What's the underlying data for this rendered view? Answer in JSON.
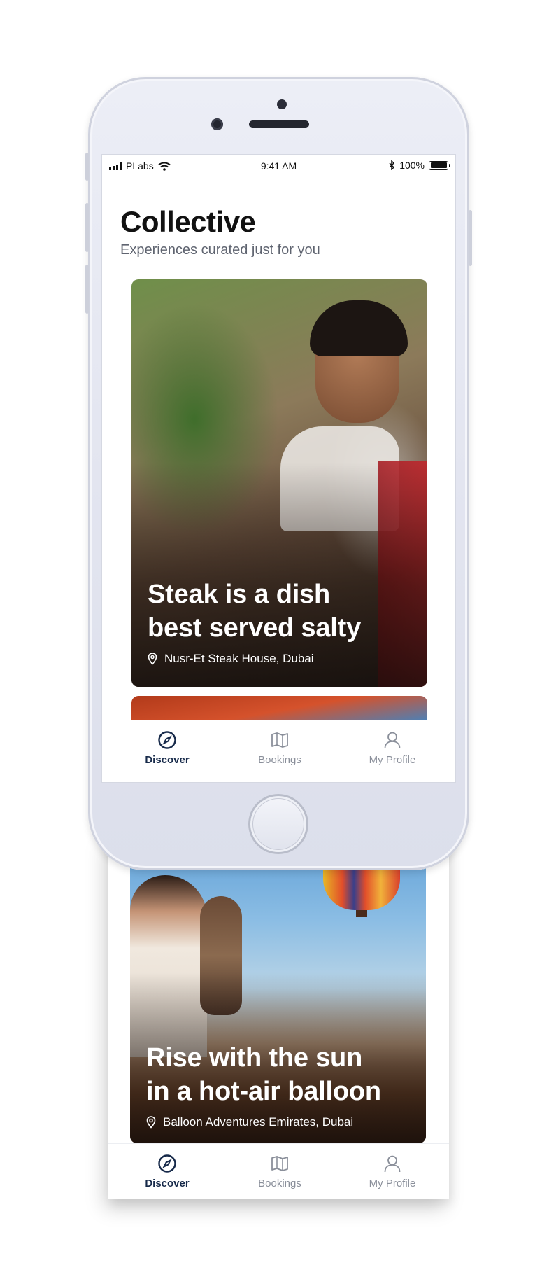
{
  "status_bar": {
    "carrier": "PLabs",
    "time": "9:41 AM",
    "battery": "100%"
  },
  "header": {
    "title": "Collective",
    "subtitle": "Experiences curated just for you"
  },
  "cards": [
    {
      "title_line1": "Steak is a dish",
      "title_line2": "best served salty",
      "location": "Nusr-Et Steak House, Dubai"
    },
    {
      "title_line1": "Rise with the sun",
      "title_line2": "in a hot-air balloon",
      "location": "Balloon Adventures Emirates, Dubai"
    }
  ],
  "tabs": [
    {
      "label": "Discover",
      "icon": "compass-icon",
      "active": true
    },
    {
      "label": "Bookings",
      "icon": "map-icon",
      "active": false
    },
    {
      "label": "My Profile",
      "icon": "user-icon",
      "active": false
    }
  ],
  "colors": {
    "accent": "#172a4a",
    "inactive": "#8a8f9a",
    "subtitle": "#5f6470"
  }
}
